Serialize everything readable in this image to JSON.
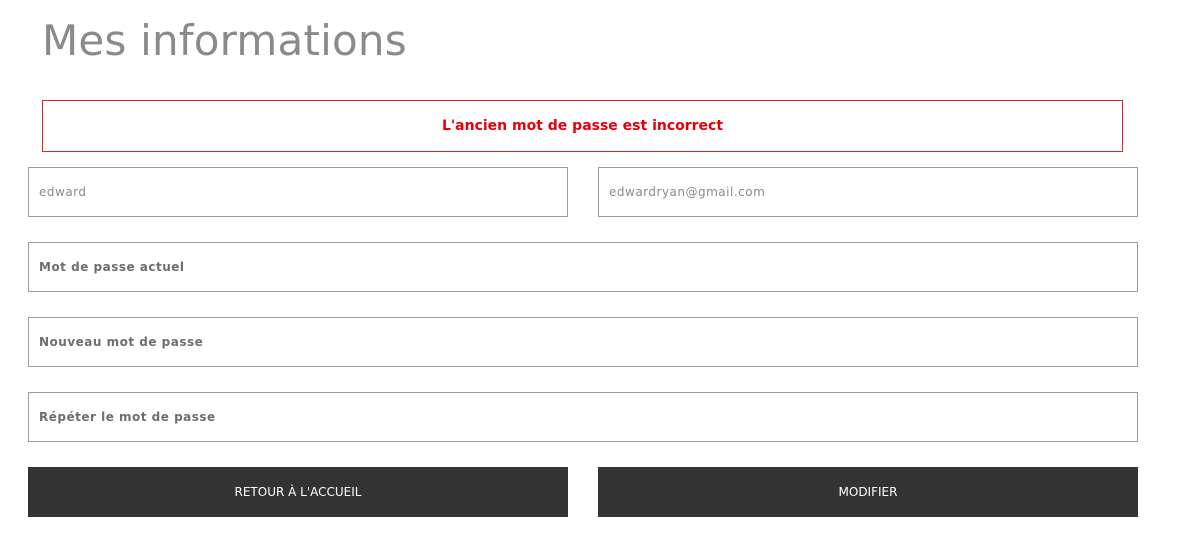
{
  "page": {
    "title": "Mes informations"
  },
  "alert": {
    "message": "L'ancien mot de passe est incorrect",
    "color": "#e3000b"
  },
  "form": {
    "first_name": {
      "value": "edward"
    },
    "email": {
      "value": "edwardryan@gmail.com"
    },
    "current_password": {
      "placeholder": "Mot de passe actuel"
    },
    "new_password": {
      "placeholder": "Nouveau mot de passe"
    },
    "repeat_password": {
      "placeholder": "Répéter le mot de passe"
    }
  },
  "actions": {
    "back_label": "RETOUR À L'ACCUEIL",
    "modify_label": "MODIFIER",
    "button_color": "#333333"
  }
}
